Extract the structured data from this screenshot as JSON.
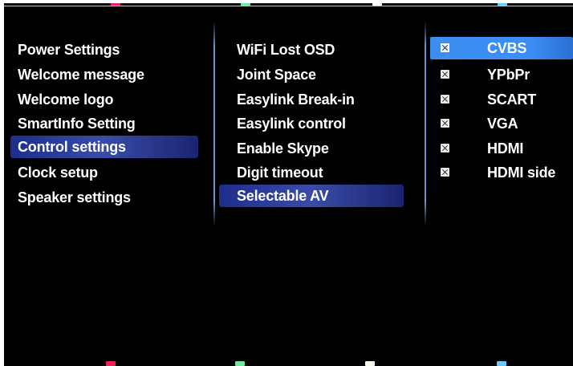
{
  "colors": {
    "red_key": "#f0205a",
    "green_key": "#6fe89e",
    "yellow_key": "#f8f8f0",
    "blue_key": "#66c9ff",
    "focus": "#3a8ef6",
    "selected": "#2d3da0"
  },
  "left_menu": [
    {
      "label": "Power Settings"
    },
    {
      "label": "Welcome message"
    },
    {
      "label": "Welcome logo"
    },
    {
      "label": "SmartInfo Setting"
    },
    {
      "label": "Control settings"
    },
    {
      "label": "Clock setup"
    },
    {
      "label": "Speaker settings"
    }
  ],
  "middle_menu": [
    {
      "label": "WiFi Lost OSD"
    },
    {
      "label": "Joint Space"
    },
    {
      "label": "Easylink Break-in"
    },
    {
      "label": "Easylink control"
    },
    {
      "label": "Enable Skype"
    },
    {
      "label": "Digit timeout"
    },
    {
      "label": "Selectable AV"
    }
  ],
  "av_options": [
    {
      "label": "CVBS",
      "checked": true
    },
    {
      "label": "YPbPr",
      "checked": true
    },
    {
      "label": "SCART",
      "checked": true
    },
    {
      "label": "VGA",
      "checked": true
    },
    {
      "label": "HDMI",
      "checked": true
    },
    {
      "label": "HDMI side",
      "checked": true
    }
  ]
}
